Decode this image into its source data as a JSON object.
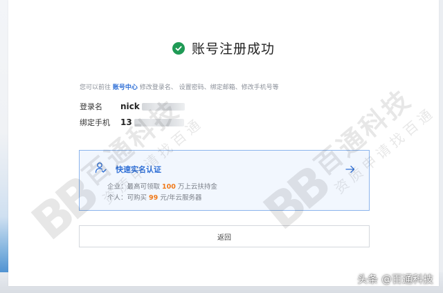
{
  "page": {
    "title": "账号注册成功",
    "hint_prefix": "您可以前往",
    "hint_link": "账号中心",
    "hint_suffix": "修改登录名、 设置密码、绑定邮箱、修改手机号等"
  },
  "account": {
    "login_label": "登录名",
    "login_value": "nick",
    "phone_label": "绑定手机",
    "phone_value": "13"
  },
  "verify_card": {
    "title": "快速实名认证",
    "enterprise_prefix": "企业：最高可领取",
    "enterprise_amount": "100",
    "enterprise_suffix": "万上云扶持金",
    "personal_prefix": "个人：可购买",
    "personal_amount": "99",
    "personal_suffix": "元/年云服务器"
  },
  "actions": {
    "back_label": "返回"
  },
  "watermark": {
    "logo": "BB",
    "company": "百通科技",
    "slogan": "资质申请找百通"
  },
  "footer": {
    "credit": "头条 @百通科技"
  },
  "colors": {
    "success_green": "#1f9a55",
    "link_blue": "#2f6fd6",
    "highlight_orange": "#f07a1a",
    "card_border": "#8bb4ec",
    "card_bg": "#f2f7fe"
  },
  "icons": {
    "success": "check-circle-icon",
    "verify": "user-check-icon",
    "go": "arrow-right-icon"
  }
}
